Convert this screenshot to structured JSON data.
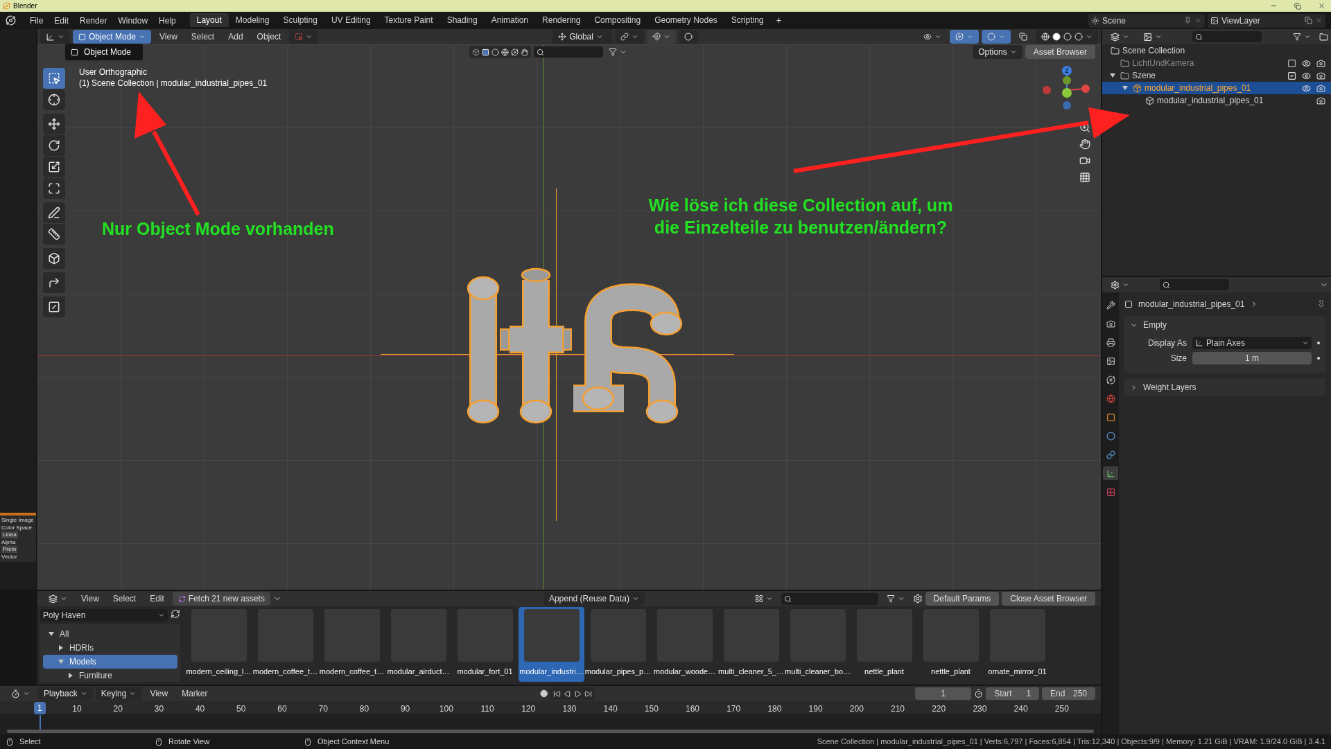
{
  "window": {
    "title": "Blender"
  },
  "menu": [
    "File",
    "Edit",
    "Render",
    "Window",
    "Help"
  ],
  "workspaces": [
    {
      "label": "Layout",
      "selected": true
    },
    {
      "label": "Modeling",
      "selected": false
    },
    {
      "label": "Sculpting",
      "selected": false
    },
    {
      "label": "UV Editing",
      "selected": false
    },
    {
      "label": "Texture Paint",
      "selected": false
    },
    {
      "label": "Shading",
      "selected": false
    },
    {
      "label": "Animation",
      "selected": false
    },
    {
      "label": "Rendering",
      "selected": false
    },
    {
      "label": "Compositing",
      "selected": false
    },
    {
      "label": "Geometry Nodes",
      "selected": false
    },
    {
      "label": "Scripting",
      "selected": false
    }
  ],
  "add_workspace": "+",
  "scene": "Scene",
  "view_layer": "ViewLayer",
  "node_strip": [
    {
      "label": "Single Image"
    },
    {
      "label": "Color Space",
      "value": "Linea"
    },
    {
      "label": "Alpha",
      "value": "Prem"
    },
    {
      "label": "Vector"
    }
  ],
  "viewport": {
    "mode": "Object Mode",
    "menu": [
      "View",
      "Select",
      "Add",
      "Object"
    ],
    "orientation": "Global",
    "mode_menu": [
      "Object Mode"
    ],
    "options": "Options",
    "asset_browser": "Asset Browser",
    "info": [
      "User Orthographic",
      "(1) Scene Collection | modular_industrial_pipes_01"
    ],
    "gizmo_label": "Z",
    "tools": [
      {
        "kind": "select",
        "selected": true
      },
      {
        "kind": "cursor",
        "selected": false
      },
      {
        "kind": "move",
        "selected": false
      },
      {
        "kind": "rotate",
        "selected": false
      },
      {
        "kind": "scale",
        "selected": false
      },
      {
        "kind": "transform",
        "selected": false
      },
      {
        "kind": "annotate",
        "selected": false
      },
      {
        "kind": "measure",
        "selected": false
      },
      {
        "kind": "add-cube",
        "selected": false
      },
      {
        "kind": "corner",
        "selected": false
      },
      {
        "kind": "diagonal",
        "selected": false
      }
    ],
    "notes": [
      "Nur Object Mode vorhanden",
      "Wie löse ich diese Collection auf, um die Einzelteile zu benutzen/ändern?"
    ]
  },
  "outliner": {
    "root": "Scene Collection",
    "items": [
      {
        "label": "LichtUndKamera",
        "kind": "collection",
        "checked": false,
        "selected": false
      },
      {
        "label": "Szene",
        "kind": "collection",
        "checked": true,
        "selected": false,
        "expanded": true,
        "children": [
          {
            "label": "modular_industrial_pipes_01",
            "kind": "instance",
            "selected": true,
            "expanded": true,
            "children": [
              {
                "label": "modular_industrial_pipes_01",
                "kind": "linked",
                "selected": false
              }
            ]
          }
        ]
      }
    ]
  },
  "properties": {
    "tabs": [
      {
        "kind": "tool",
        "selected": false
      },
      {
        "kind": "render",
        "selected": false
      },
      {
        "kind": "output",
        "selected": false
      },
      {
        "kind": "view-layer",
        "selected": false
      },
      {
        "kind": "scene",
        "selected": false
      },
      {
        "kind": "world",
        "selected": false
      },
      {
        "kind": "object",
        "selected": false
      },
      {
        "kind": "physics",
        "selected": false
      },
      {
        "kind": "constraints",
        "selected": false
      },
      {
        "kind": "data",
        "selected": true
      },
      {
        "kind": "texture",
        "selected": false
      }
    ],
    "object": "modular_industrial_pipes_01",
    "panels": [
      {
        "title": "Empty",
        "expanded": true,
        "fields": [
          {
            "label": "Display As",
            "value": "Plain Axes",
            "kind": "dropdown"
          },
          {
            "label": "Size",
            "value": "1 m",
            "kind": "number"
          }
        ]
      },
      {
        "title": "Weight Layers",
        "expanded": false
      }
    ]
  },
  "asset_browser": {
    "menu": [
      "View",
      "Select",
      "Edit"
    ],
    "fetch": "Fetch 21 new assets",
    "import": "Append (Reuse Data)",
    "default_params": "Default Params",
    "close": "Close Asset Browser",
    "library": "Poly Haven",
    "tree": [
      {
        "label": "All",
        "expanded": true,
        "selected": false,
        "children": [
          {
            "label": "HDRIs",
            "expanded": false,
            "selected": false
          },
          {
            "label": "Models",
            "expanded": true,
            "selected": true,
            "children": [
              {
                "label": "Furniture",
                "expanded": false,
                "selected": false
              }
            ]
          }
        ]
      }
    ],
    "assets": [
      {
        "name": "modern_ceiling_l…",
        "selected": false
      },
      {
        "name": "modern_coffee_t…",
        "selected": false
      },
      {
        "name": "modern_coffee_t…",
        "selected": false
      },
      {
        "name": "modular_airduct…",
        "selected": false
      },
      {
        "name": "modular_fort_01",
        "selected": false
      },
      {
        "name": "modular_industri…",
        "selected": true
      },
      {
        "name": "modular_pipes_p…",
        "selected": false
      },
      {
        "name": "modular_woode…",
        "selected": false
      },
      {
        "name": "multi_cleaner_5_…",
        "selected": false
      },
      {
        "name": "multi_cleaner_bo…",
        "selected": false
      },
      {
        "name": "nettle_plant",
        "selected": false
      },
      {
        "name": "nettle_plant",
        "selected": false
      },
      {
        "name": "ornate_mirror_01",
        "selected": false
      }
    ]
  },
  "timeline": {
    "menu": [
      "Playback",
      "Keying",
      "View",
      "Marker"
    ],
    "current_frame": "1",
    "frame_field": "1",
    "start_label": "Start",
    "start": "1",
    "end_label": "End",
    "end": "250",
    "ticks": [
      "10",
      "20",
      "30",
      "40",
      "50",
      "60",
      "70",
      "80",
      "90",
      "100",
      "110",
      "120",
      "130",
      "140",
      "150",
      "160",
      "170",
      "180",
      "190",
      "200",
      "210",
      "220",
      "230",
      "240",
      "250"
    ]
  },
  "status_bar": {
    "hints": [
      "Select",
      "Rotate View",
      "Object Context Menu"
    ],
    "stats": "Scene Collection | modular_industrial_pipes_01 | Verts:6,797 | Faces:6,854 | Tris:12,340 | Objects:9/9 | Memory: 1.21 GiB | VRAM: 1.9/24.0 GiB | 3.4.1"
  }
}
